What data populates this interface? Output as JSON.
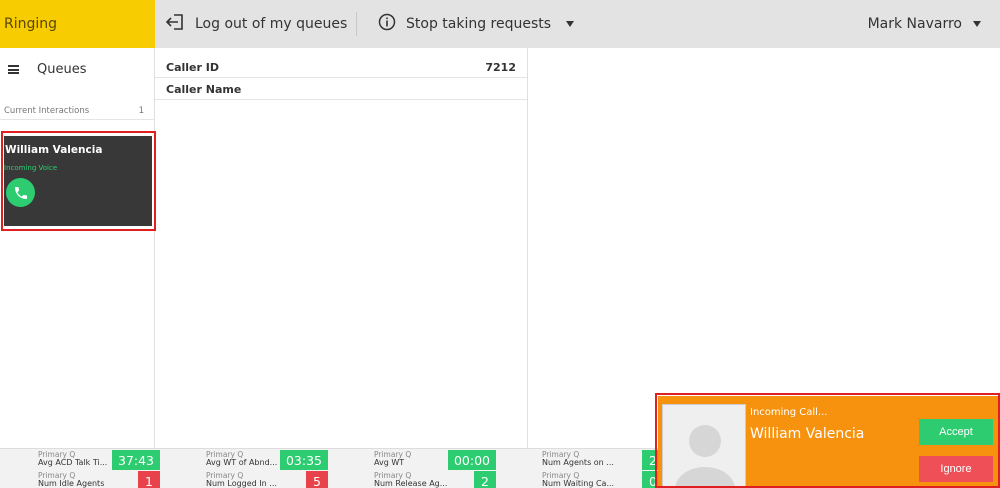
{
  "topbar": {
    "status": "Ringing",
    "logout_label": "Log out of my queues",
    "stop_label": "Stop taking requests",
    "user_name": "Mark Navarro"
  },
  "sidebar": {
    "queues_label": "Queues",
    "current_interactions_label": "Current Interactions",
    "current_interactions_count": "1",
    "interaction": {
      "name": "William Valencia",
      "type": "Incoming Voice"
    }
  },
  "details": {
    "rows": [
      {
        "key": "Caller ID",
        "value": "7212"
      },
      {
        "key": "Caller Name",
        "value": ""
      }
    ]
  },
  "stats": {
    "row1": [
      {
        "queue": "Primary Q",
        "metric": "Avg ACD Talk Ti...",
        "value": "37:43",
        "color": "#2ecc71"
      },
      {
        "queue": "Primary Q",
        "metric": "Avg WT of Abnd...",
        "value": "03:35",
        "color": "#2ecc71"
      },
      {
        "queue": "Primary Q",
        "metric": "Avg WT",
        "value": "00:00",
        "color": "#2ecc71"
      },
      {
        "queue": "Primary Q",
        "metric": "Num Agents on ...",
        "value": "2",
        "color": "#2ecc71"
      }
    ],
    "row2": [
      {
        "queue": "Primary Q",
        "metric": "Num Idle Agents",
        "value": "1",
        "color": "#e8424b"
      },
      {
        "queue": "Primary Q",
        "metric": "Num Logged In ...",
        "value": "5",
        "color": "#e8424b"
      },
      {
        "queue": "Primary Q",
        "metric": "Num Release Ag...",
        "value": "2",
        "color": "#2ecc71"
      },
      {
        "queue": "Primary Q",
        "metric": "Num Waiting Ca...",
        "value": "0",
        "color": "#2ecc71"
      }
    ]
  },
  "toast": {
    "title": "Incoming Call...",
    "caller_name": "William Valencia",
    "accept_label": "Accept",
    "ignore_label": "Ignore"
  },
  "colors": {
    "status_bg": "#f7cc00",
    "toast_bg": "#f7920f",
    "accept": "#2ecc71",
    "ignore": "#ef5057",
    "highlight": "#e02020"
  }
}
